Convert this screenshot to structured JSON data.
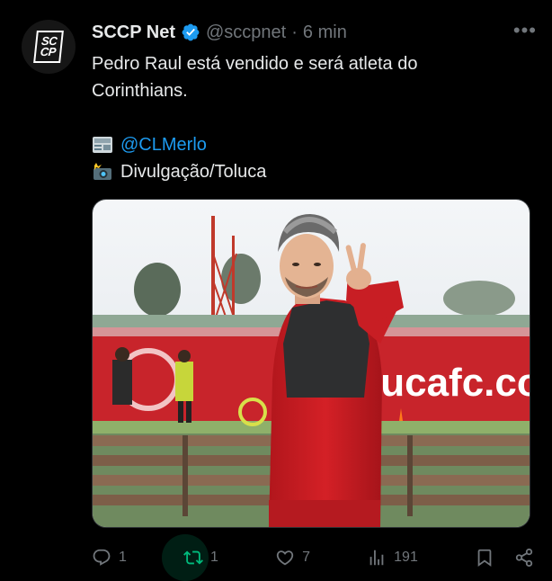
{
  "author": {
    "avatar_text": "SC CP",
    "name": "SCCP Net",
    "handle": "@sccpnet",
    "separator": "·",
    "time": "6 min",
    "verified": true
  },
  "tweet": {
    "text_line1": "Pedro Raul está vendido e será atleta do",
    "text_line2": "Corinthians.",
    "credit_link": "@CLMerlo",
    "credit_photo": "Divulgação/Toluca"
  },
  "media": {
    "banner_text": "lucafc.com",
    "description_icon": "photo"
  },
  "actions": {
    "reply_count": "1",
    "retweet_count": "1",
    "like_count": "7",
    "views_count": "191"
  },
  "icons": [
    "more-icon",
    "verified-icon",
    "newspaper-icon",
    "camera-flash-icon",
    "reply-icon",
    "retweet-icon",
    "like-icon",
    "views-icon",
    "bookmark-icon",
    "share-icon"
  ],
  "colors": {
    "background": "#000000",
    "text": "#e7e9ea",
    "muted": "#71767b",
    "link": "#1d9bf0",
    "retweet_active": "#00ba7c"
  }
}
